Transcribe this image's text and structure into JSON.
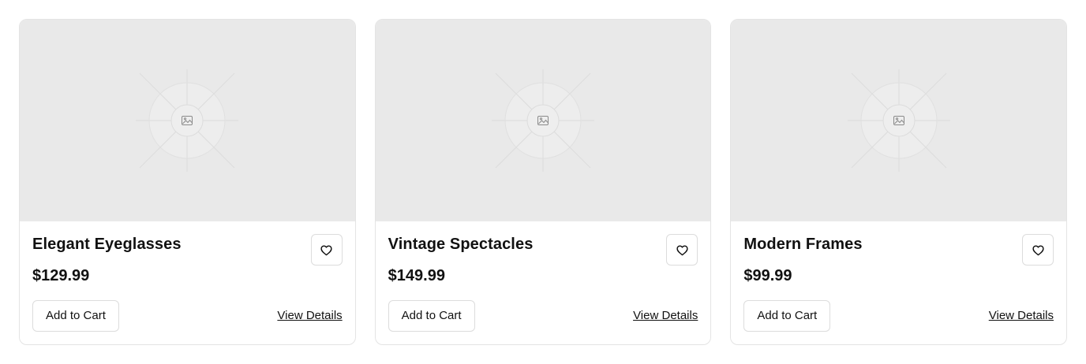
{
  "products": [
    {
      "name": "Elegant Eyeglasses",
      "price": "$129.99",
      "image_icon": "image-placeholder-icon",
      "favorite_icon": "heart-outline-icon",
      "add_to_cart_label": "Add to Cart",
      "view_details_label": "View Details"
    },
    {
      "name": "Vintage Spectacles",
      "price": "$149.99",
      "image_icon": "image-placeholder-icon",
      "favorite_icon": "heart-outline-icon",
      "add_to_cart_label": "Add to Cart",
      "view_details_label": "View Details"
    },
    {
      "name": "Modern Frames",
      "price": "$99.99",
      "image_icon": "image-placeholder-icon",
      "favorite_icon": "heart-outline-icon",
      "add_to_cart_label": "Add to Cart",
      "view_details_label": "View Details"
    }
  ],
  "colors": {
    "image_background": "#e9e9e9",
    "card_border": "#e4e4e4",
    "button_border": "#dcdcdc",
    "text": "#111111"
  }
}
